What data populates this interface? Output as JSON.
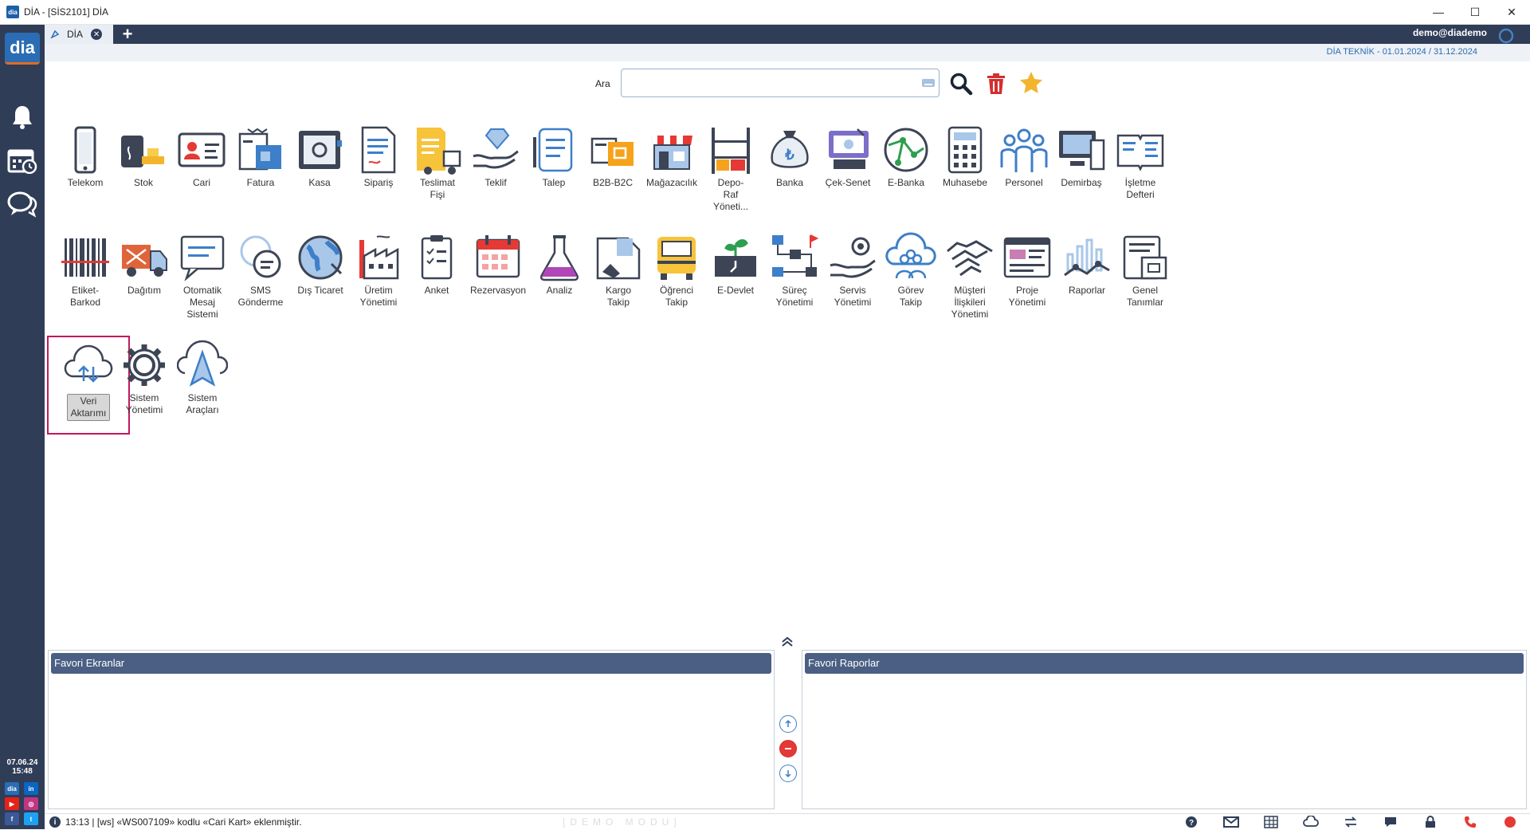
{
  "window": {
    "title": "DİA - [SİS2101] DİA",
    "minimize": "—",
    "maximize": "☐",
    "close": "✕"
  },
  "sidebar": {
    "logo": "dia",
    "date": "07.06.24",
    "time": "15:48"
  },
  "tab": {
    "label": "DİA",
    "close": "✕",
    "add": "+"
  },
  "header": {
    "user": "demo@diademo",
    "company": "DİA TEKNİK -  01.01.2024 / 31.12.2024"
  },
  "search": {
    "label": "Ara",
    "value": "",
    "placeholder": ""
  },
  "modules": [
    {
      "label": "Telekom",
      "icon": "phone-icon"
    },
    {
      "label": "Stok",
      "icon": "barrel-gold-icon"
    },
    {
      "label": "Cari",
      "icon": "id-card-icon"
    },
    {
      "label": "Fatura",
      "icon": "invoice-icon"
    },
    {
      "label": "Kasa",
      "icon": "safe-icon"
    },
    {
      "label": "Sipariş",
      "icon": "order-document-icon"
    },
    {
      "label": "Teslimat\nFişi",
      "icon": "delivery-truck-icon"
    },
    {
      "label": "Teklif",
      "icon": "diamond-hand-icon"
    },
    {
      "label": "Talep",
      "icon": "request-scroll-icon"
    },
    {
      "label": "B2B-B2C",
      "icon": "b2b-cards-icon"
    },
    {
      "label": "Mağazacılık",
      "icon": "store-icon"
    },
    {
      "label": "Depo-\nRaf\nYöneti...",
      "icon": "shelf-icon"
    },
    {
      "label": "Banka",
      "icon": "money-bag-icon"
    },
    {
      "label": "Çek-Senet",
      "icon": "cheque-icon"
    },
    {
      "label": "E-Banka",
      "icon": "globe-network-icon"
    },
    {
      "label": "Muhasebe",
      "icon": "calculator-icon"
    },
    {
      "label": "Personel",
      "icon": "people-icon"
    },
    {
      "label": "Demirbaş",
      "icon": "computer-icon"
    },
    {
      "label": "İşletme\nDefteri",
      "icon": "open-book-icon"
    },
    {
      "label": "Etiket-\nBarkod",
      "icon": "barcode-icon"
    },
    {
      "label": "Dağıtım",
      "icon": "distribution-truck-icon"
    },
    {
      "label": "Otomatik\nMesaj\nSistemi",
      "icon": "message-board-icon"
    },
    {
      "label": "SMS\nGönderme",
      "icon": "sms-bubble-icon"
    },
    {
      "label": "Dış Ticaret",
      "icon": "world-globe-icon"
    },
    {
      "label": "Üretim\nYönetimi",
      "icon": "factory-icon"
    },
    {
      "label": "Anket",
      "icon": "survey-clipboard-icon"
    },
    {
      "label": "Rezervasyon",
      "icon": "calendar-icon"
    },
    {
      "label": "Analiz",
      "icon": "flask-icon"
    },
    {
      "label": "Kargo\nTakip",
      "icon": "cargo-box-icon"
    },
    {
      "label": "Öğrenci\nTakip",
      "icon": "school-bus-icon"
    },
    {
      "label": "E-Devlet",
      "icon": "plant-sign-icon"
    },
    {
      "label": "Süreç\nYönetimi",
      "icon": "process-flow-icon"
    },
    {
      "label": "Servis\nYönetimi",
      "icon": "service-hand-gear-icon"
    },
    {
      "label": "Görev\nTakip",
      "icon": "team-cloud-icon"
    },
    {
      "label": "Müşteri\nİlişkileri\nYönetimi",
      "icon": "handshake-icon"
    },
    {
      "label": "Proje\nYönetimi",
      "icon": "project-window-icon"
    },
    {
      "label": "Raporlar",
      "icon": "report-chart-icon"
    },
    {
      "label": "Genel\nTanımlar",
      "icon": "general-settings-doc-icon"
    },
    {
      "label": "Veri\nAktarımı",
      "icon": "cloud-transfer-icon"
    },
    {
      "label": "Sistem\nYönetimi",
      "icon": "gear-icon"
    },
    {
      "label": "Sistem\nAraçları",
      "icon": "cloud-send-icon"
    }
  ],
  "favorites": {
    "screens": "Favori Ekranlar",
    "reports": "Favori Raporlar"
  },
  "status": {
    "message": "13:13 | [ws] «WS007109» kodlu «Cari Kart» eklenmiştir.",
    "mode": "[DEMO MODU]"
  },
  "colors": {
    "sidebar": "#2f3d57",
    "accent": "#2a6db5",
    "selected_outline": "#c2185b"
  }
}
